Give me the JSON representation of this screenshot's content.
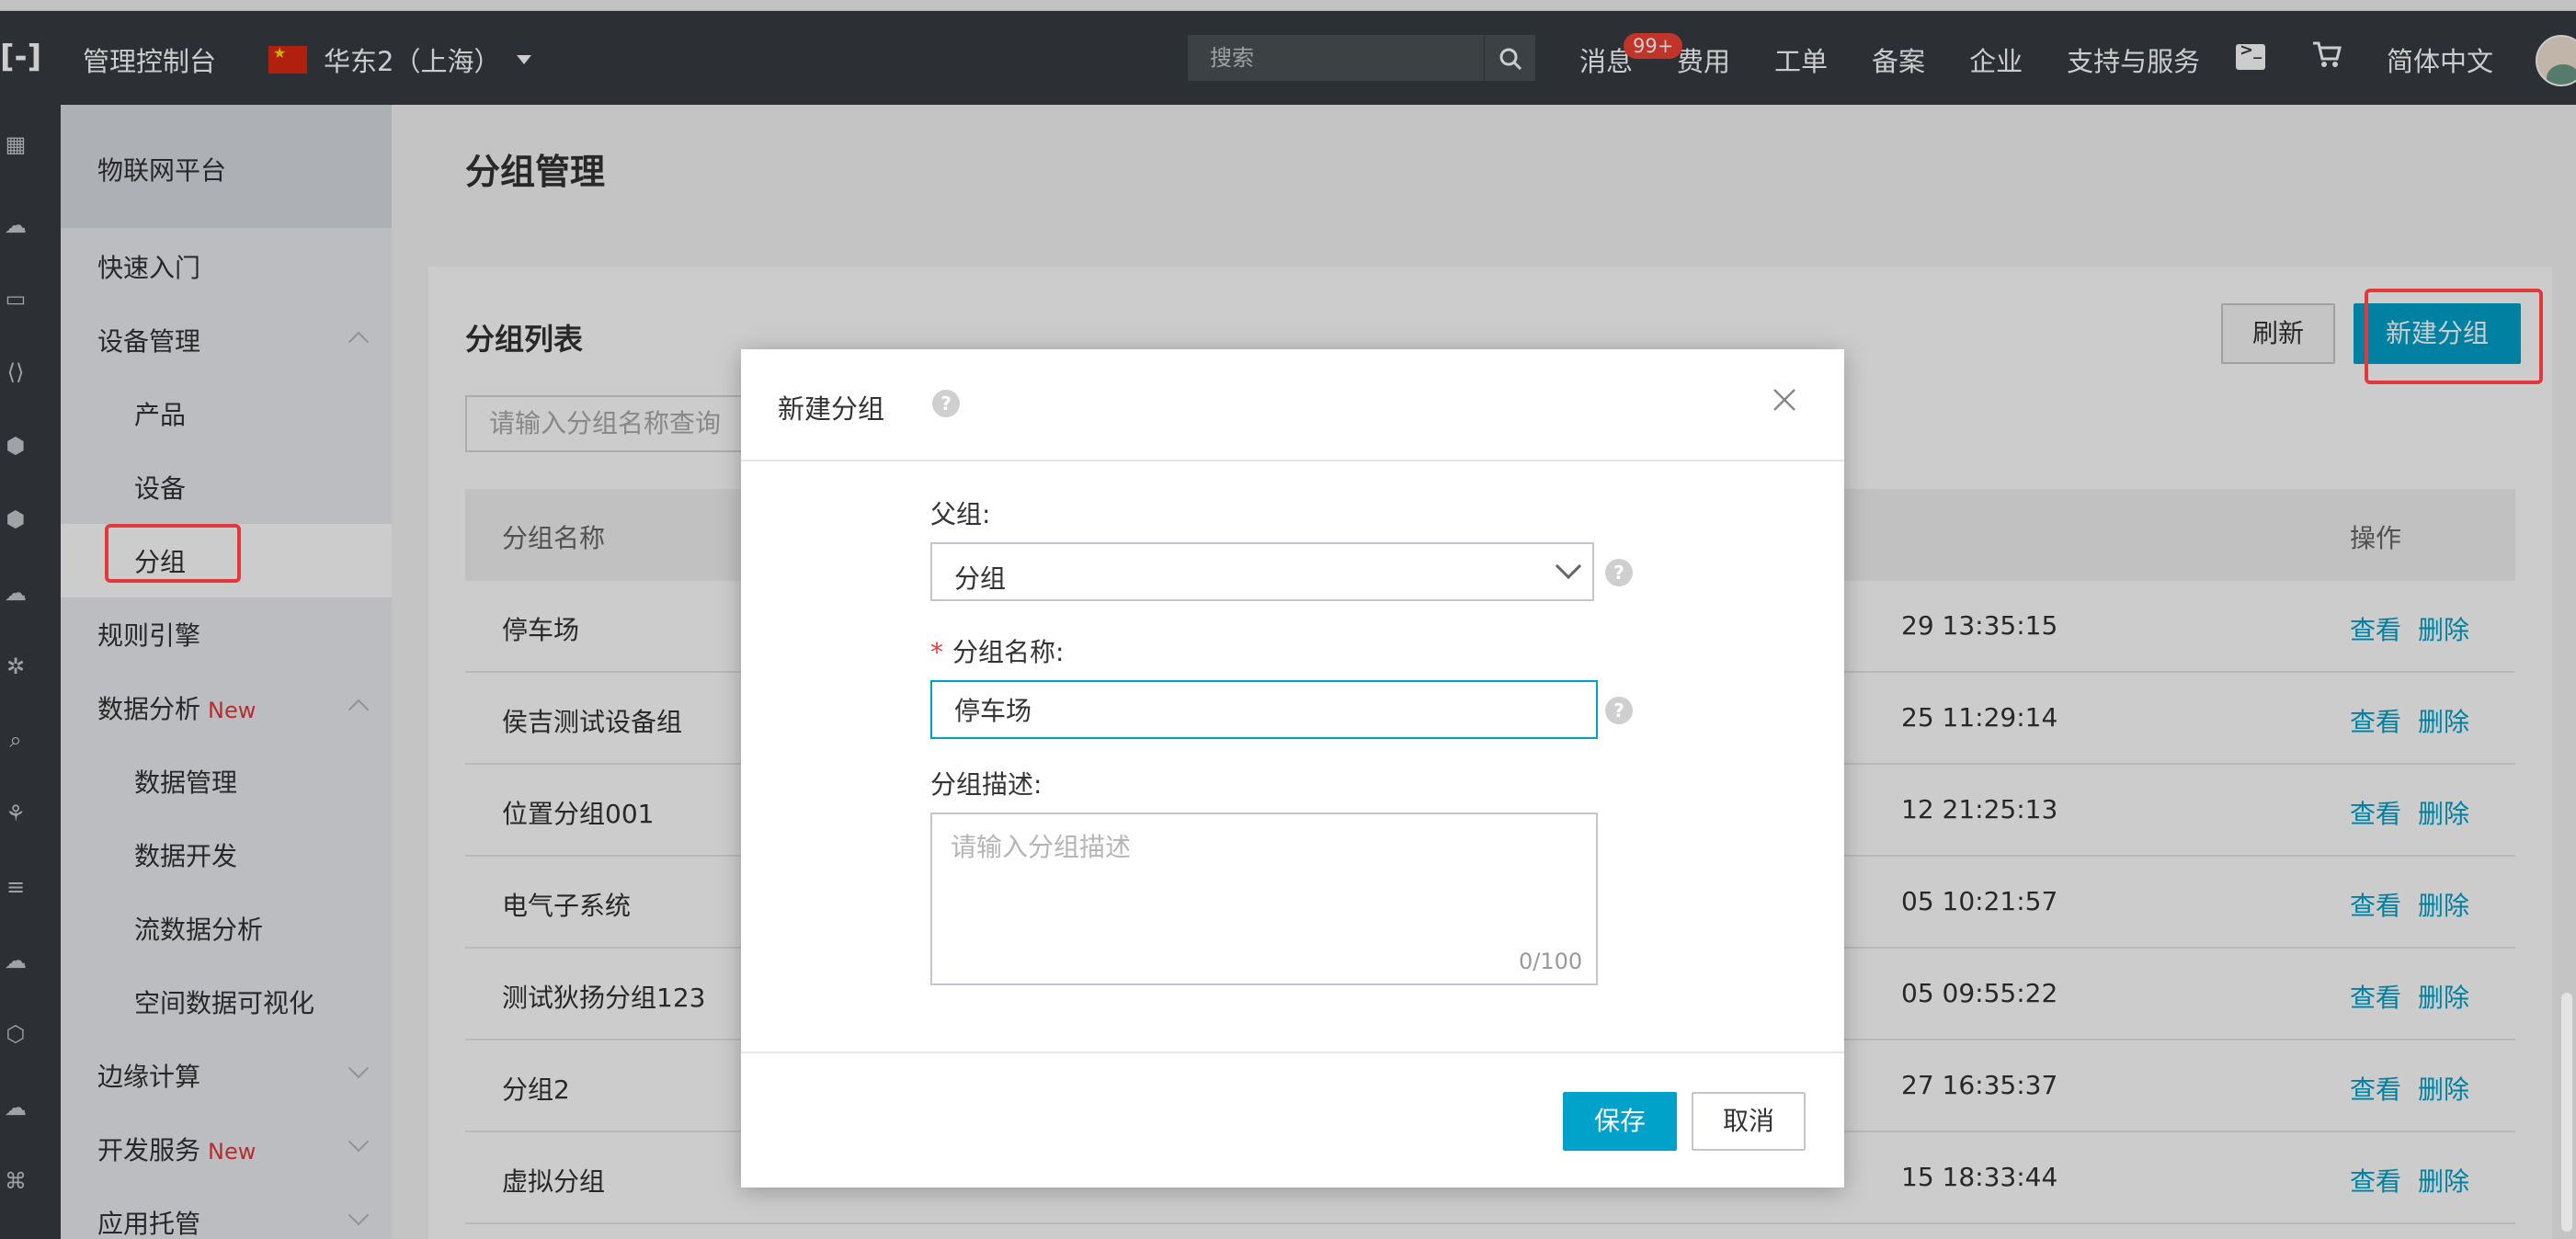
{
  "topbar": {
    "logo": "[-]",
    "console": "管理控制台",
    "region": "华东2（上海）",
    "search_placeholder": "搜索",
    "nav": [
      "消息",
      "费用",
      "工单",
      "备案",
      "企业",
      "支持与服务"
    ],
    "badge": "99+",
    "lang": "简体中文"
  },
  "sidebar": {
    "title": "物联网平台",
    "items": {
      "quickstart": "快速入门",
      "device_mgmt": "设备管理",
      "product": "产品",
      "device": "设备",
      "group": "分组",
      "rules": "规则引擎",
      "data_analysis": "数据分析",
      "data_analysis_new": "New",
      "data_mgmt": "数据管理",
      "data_dev": "数据开发",
      "stream": "流数据分析",
      "spatial": "空间数据可视化",
      "edge": "边缘计算",
      "dev_service": "开发服务",
      "dev_service_new": "New",
      "app_hosting": "应用托管"
    }
  },
  "main": {
    "page_title": "分组管理",
    "panel_title": "分组列表",
    "refresh": "刷新",
    "new_group": "新建分组",
    "filter_placeholder": "请输入分组名称查询",
    "columns": {
      "name": "分组名称",
      "ops": "操作"
    },
    "rows": [
      {
        "name": "停车场",
        "time": "29 13:35:15"
      },
      {
        "name": "侯吉测试设备组",
        "time": "25 11:29:14"
      },
      {
        "name": "位置分组001",
        "time": "12 21:25:13"
      },
      {
        "name": "电气子系统",
        "time": "05 10:21:57"
      },
      {
        "name": "测试狄扬分组123",
        "time": "05 09:55:22"
      },
      {
        "name": "分组2",
        "time": "27 16:35:37"
      },
      {
        "name": "虚拟分组",
        "time": "15 18:33:44"
      }
    ],
    "action_view": "查看",
    "action_delete": "删除"
  },
  "modal": {
    "title": "新建分组",
    "help": "?",
    "parent_label": "父组:",
    "parent_value": "分组",
    "name_label": "分组名称:",
    "name_value": "停车场",
    "desc_label": "分组描述:",
    "desc_placeholder": "请输入分组描述",
    "counter": "0/100",
    "save": "保存",
    "cancel": "取消"
  }
}
